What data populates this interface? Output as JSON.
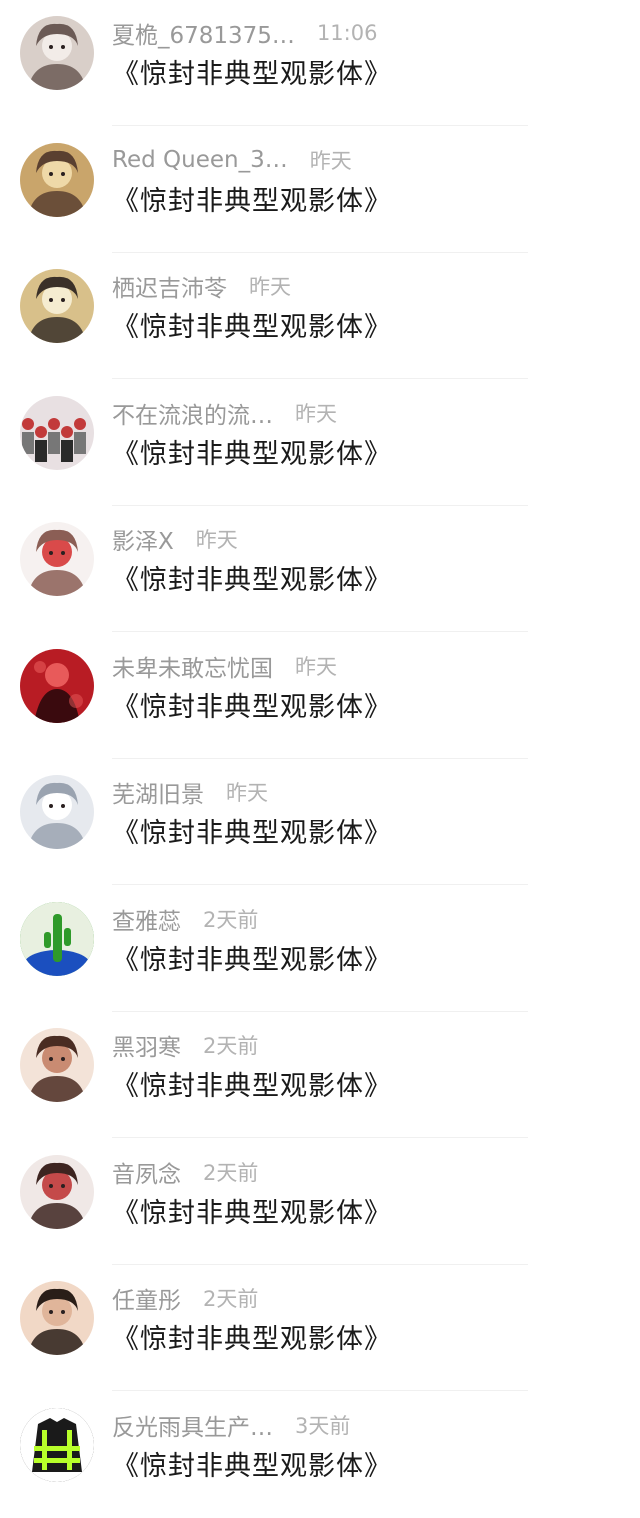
{
  "conversations": [
    {
      "name": "夏桅_6781375…",
      "time": "11:06",
      "message": "《惊封非典型观影体》",
      "avatar_icon": "avatar-girl-muted-icon",
      "avatar_colors": [
        "#d9cfc9",
        "#6b5a55",
        "#f2ece8"
      ]
    },
    {
      "name": "Red Queen_3…",
      "time": "昨天",
      "message": "《惊封非典型观影体》",
      "avatar_icon": "avatar-golden-illustration-icon",
      "avatar_colors": [
        "#c9a56b",
        "#5a4030",
        "#efd9a8"
      ]
    },
    {
      "name": "栖迟吉沛苓",
      "time": "昨天",
      "message": "《惊封非典型观影体》",
      "avatar_icon": "avatar-anime-boy-icon",
      "avatar_colors": [
        "#d8c08a",
        "#3a3028",
        "#f5ecd0"
      ]
    },
    {
      "name": "不在流浪的流…",
      "time": "昨天",
      "message": "《惊封非典型观影体》",
      "avatar_icon": "avatar-group-collage-icon",
      "avatar_colors": [
        "#e8e0e2",
        "#c23a3a",
        "#2a2a2a"
      ]
    },
    {
      "name": "影泽X",
      "time": "昨天",
      "message": "《惊封非典型观影体》",
      "avatar_icon": "avatar-chibi-character-icon",
      "avatar_colors": [
        "#f6f1f0",
        "#8b5e55",
        "#d94a4a"
      ]
    },
    {
      "name": "未卑未敢忘忧国",
      "time": "昨天",
      "message": "《惊封非典型观影体》",
      "avatar_icon": "avatar-red-figure-icon",
      "avatar_colors": [
        "#b81c24",
        "#3a0a0e",
        "#e85a5a"
      ]
    },
    {
      "name": "芜湖旧景",
      "time": "昨天",
      "message": "《惊封非典型观影体》",
      "avatar_icon": "avatar-white-hair-girl-icon",
      "avatar_colors": [
        "#e6e9ee",
        "#9aa3b0",
        "#ffffff"
      ]
    },
    {
      "name": "查雅蕊",
      "time": "2天前",
      "message": "《惊封非典型观影体》",
      "avatar_icon": "avatar-cactus-plant-icon",
      "avatar_colors": [
        "#2f9a2a",
        "#1b4fbf",
        "#e8f0e0"
      ]
    },
    {
      "name": "黑羽寒",
      "time": "2天前",
      "message": "《惊封非典型观影体》",
      "avatar_icon": "avatar-brown-hair-girl-icon",
      "avatar_colors": [
        "#f3e3d8",
        "#4a2c22",
        "#c98b72"
      ]
    },
    {
      "name": "音夙念",
      "time": "2天前",
      "message": "《惊封非典型观影体》",
      "avatar_icon": "avatar-floral-character-icon",
      "avatar_colors": [
        "#f0e8e6",
        "#3d2420",
        "#c44a4a"
      ]
    },
    {
      "name": "任童彤",
      "time": "2天前",
      "message": "《惊封非典型观影体》",
      "avatar_icon": "avatar-smiling-boy-icon",
      "avatar_colors": [
        "#f1d8c6",
        "#2a1e18",
        "#e0b59a"
      ]
    },
    {
      "name": "反光雨具生产…",
      "time": "3天前",
      "message": "《惊封非典型观影体》",
      "avatar_icon": "avatar-reflective-jacket-icon",
      "avatar_colors": [
        "#1a1a1a",
        "#b8ff2a",
        "#3a3a3a"
      ]
    }
  ]
}
